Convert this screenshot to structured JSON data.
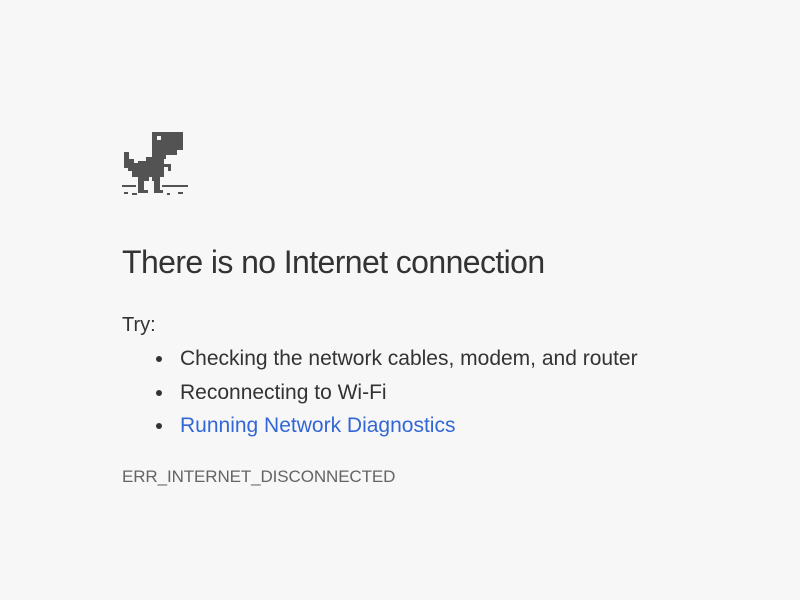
{
  "illustration": {
    "icon": "offline-dinosaur-icon",
    "color": "#535353"
  },
  "error": {
    "title": "There is no Internet connection",
    "try_label": "Try:",
    "suggestions": [
      {
        "label": "Checking the network cables, modem, and router"
      },
      {
        "label": "Reconnecting to Wi-Fi"
      },
      {
        "label": "Running Network Diagnostics"
      }
    ],
    "code": "ERR_INTERNET_DISCONNECTED"
  },
  "colors": {
    "background": "#f7f7f7",
    "text": "#333333",
    "link": "#3367d6",
    "error_code": "#646464"
  }
}
